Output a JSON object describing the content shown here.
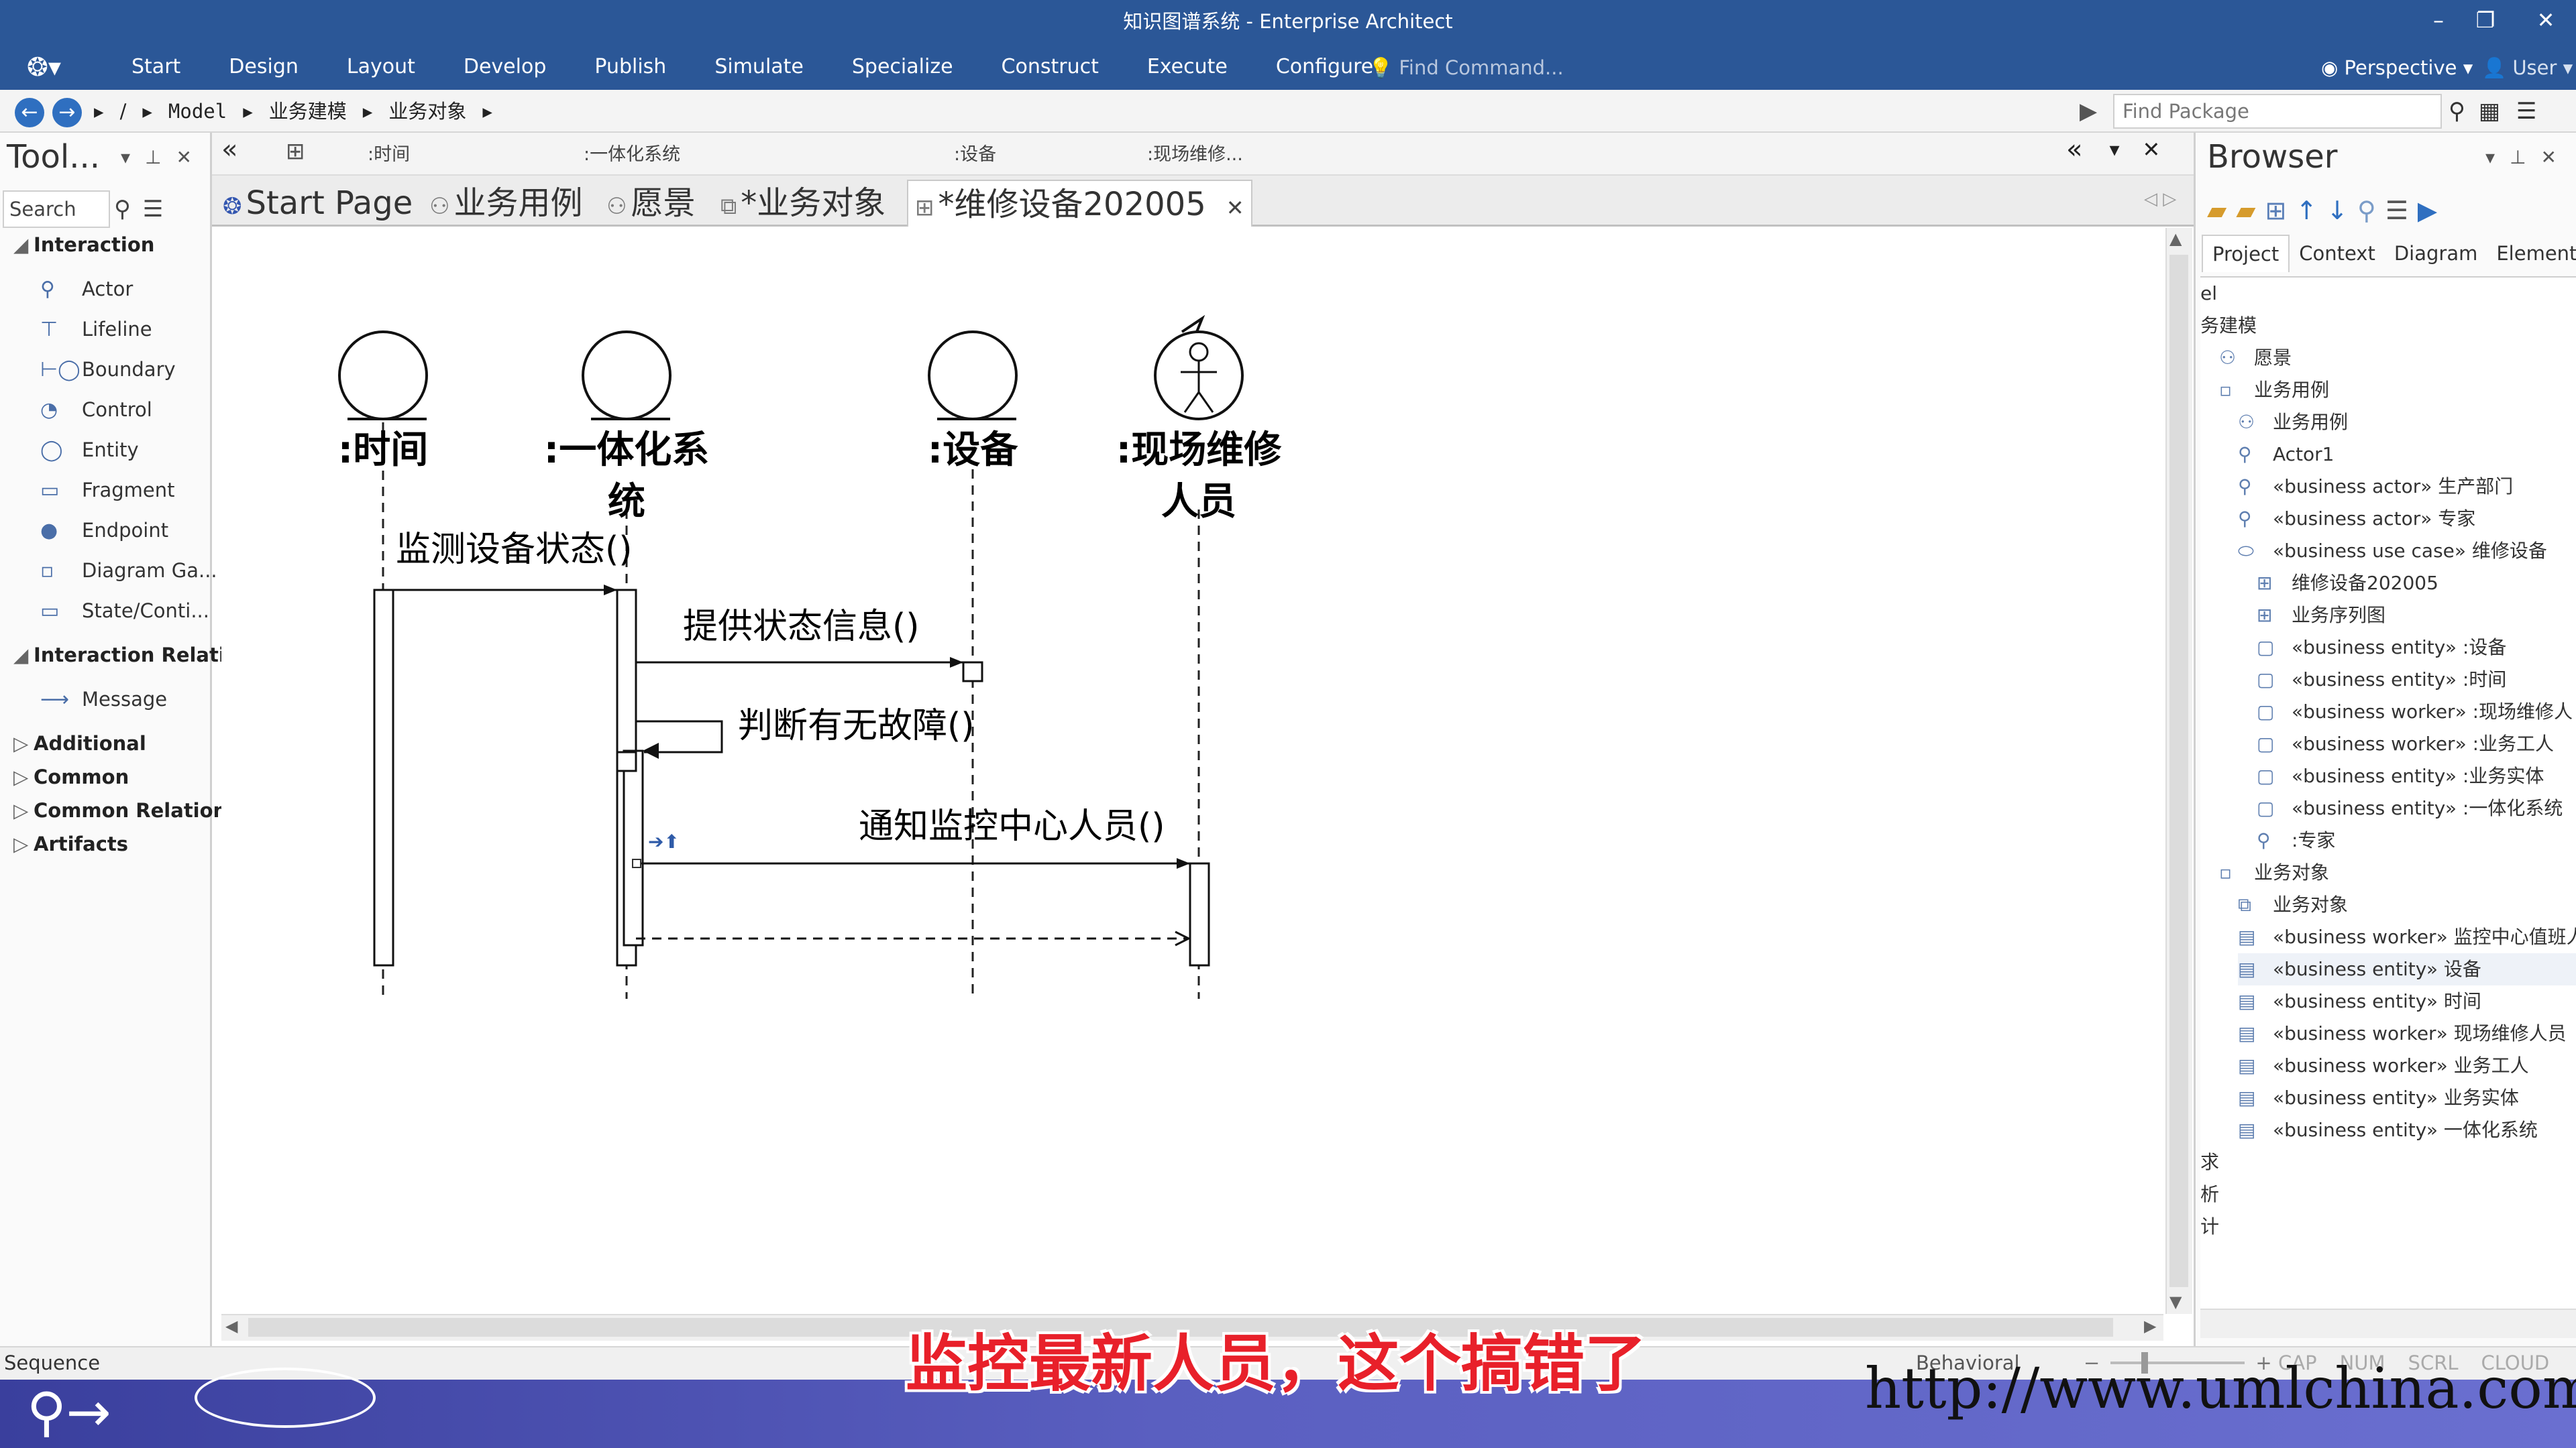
{
  "window": {
    "title": "知识图谱系统 - Enterprise Architect",
    "minimize_glyph": "–",
    "restore_glyph": "❐",
    "close_glyph": "✕"
  },
  "ribbon": {
    "logo_icon": "ea-logo-icon",
    "menu": [
      "Start",
      "Design",
      "Layout",
      "Develop",
      "Publish",
      "Simulate",
      "Specialize",
      "Construct",
      "Execute",
      "Configure"
    ],
    "find_command_placeholder": "Find Command...",
    "perspective_label": "Perspective",
    "user_label": "User"
  },
  "navbar": {
    "breadcrumbs": [
      "/",
      "Model",
      "业务建模",
      "业务对象"
    ],
    "find_package_placeholder": "Find Package"
  },
  "toolbox": {
    "title": "Tool...",
    "search_placeholder": "Search",
    "groups": [
      {
        "label": "Interaction",
        "expanded": true,
        "items": [
          {
            "label": "Actor",
            "icon": "actor-icon"
          },
          {
            "label": "Lifeline",
            "icon": "lifeline-icon"
          },
          {
            "label": "Boundary",
            "icon": "boundary-icon"
          },
          {
            "label": "Control",
            "icon": "control-icon"
          },
          {
            "label": "Entity",
            "icon": "entity-icon"
          },
          {
            "label": "Fragment",
            "icon": "fragment-icon"
          },
          {
            "label": "Endpoint",
            "icon": "endpoint-icon"
          },
          {
            "label": "Diagram Ga...",
            "icon": "diagram-gate-icon"
          },
          {
            "label": "State/Conti...",
            "icon": "state-continuation-icon"
          }
        ]
      },
      {
        "label": "Interaction Relatio",
        "expanded": true,
        "items": [
          {
            "label": "Message",
            "icon": "message-arrow-icon"
          }
        ]
      },
      {
        "label": "Additional",
        "expanded": false,
        "items": []
      },
      {
        "label": "Common",
        "expanded": false,
        "items": []
      },
      {
        "label": "Common Relations",
        "expanded": false,
        "items": []
      },
      {
        "label": "Artifacts",
        "expanded": false,
        "items": []
      }
    ]
  },
  "diagram_header": {
    "labels": [
      ":时间",
      ":一体化系统",
      ":设备",
      ":现场维修..."
    ]
  },
  "tabs": [
    {
      "label": "Start Page",
      "icon": "start-page-icon",
      "active": false
    },
    {
      "label": "业务用例",
      "icon": "use-case-diagram-icon",
      "active": false
    },
    {
      "label": "愿景",
      "icon": "use-case-diagram-icon",
      "active": false
    },
    {
      "label": "*业务对象",
      "icon": "class-diagram-icon",
      "active": false
    },
    {
      "label": "*维修设备202005",
      "icon": "sequence-diagram-icon",
      "active": true
    }
  ],
  "diagram": {
    "lifelines": [
      {
        "name": ":时间",
        "kind": "entity"
      },
      {
        "name": ":一体化系统",
        "line1": ":一体化系",
        "line2": "统",
        "kind": "entity"
      },
      {
        "name": ":设备",
        "kind": "entity"
      },
      {
        "name": ":现场维修人员",
        "line1": ":现场维修",
        "line2": "人员",
        "kind": "worker"
      }
    ],
    "messages": [
      {
        "label": "监测设备状态()",
        "from": ":时间",
        "to": ":一体化系统"
      },
      {
        "label": "提供状态信息()",
        "from": ":一体化系统",
        "to": ":设备"
      },
      {
        "label": "判断有无故障()",
        "from": ":一体化系统",
        "to": ":一体化系统"
      },
      {
        "label": "通知监控中心人员()",
        "from": ":一体化系统",
        "to": ":现场维修人员"
      },
      {
        "label": "",
        "from": ":现场维修人员",
        "to": ":一体化系统",
        "return": true
      }
    ]
  },
  "browser": {
    "title": "Browser",
    "tabs": [
      "Project",
      "Context",
      "Diagram",
      "Element"
    ],
    "active_tab": "Project",
    "tree": [
      {
        "label": "el",
        "indent": 0,
        "icon": ""
      },
      {
        "label": "务建模",
        "indent": 0,
        "icon": ""
      },
      {
        "label": "愿景",
        "indent": 1,
        "icon": "use-case-diagram-icon"
      },
      {
        "label": "业务用例",
        "indent": 1,
        "icon": "package-icon"
      },
      {
        "label": "业务用例",
        "indent": 2,
        "icon": "use-case-diagram-icon"
      },
      {
        "label": "Actor1",
        "indent": 2,
        "icon": "actor-icon"
      },
      {
        "label": "«business actor» 生产部门",
        "indent": 2,
        "icon": "actor-icon"
      },
      {
        "label": "«business actor» 专家",
        "indent": 2,
        "icon": "actor-icon"
      },
      {
        "label": "«business use case» 维修设备",
        "indent": 2,
        "icon": "use-case-icon"
      },
      {
        "label": "维修设备202005",
        "indent": 3,
        "icon": "sequence-diagram-icon"
      },
      {
        "label": "业务序列图",
        "indent": 3,
        "icon": "sequence-diagram-icon"
      },
      {
        "label": "«business entity» :设备",
        "indent": 3,
        "icon": "object-icon"
      },
      {
        "label": "«business entity» :时间",
        "indent": 3,
        "icon": "object-icon"
      },
      {
        "label": "«business worker» :现场维修人",
        "indent": 3,
        "icon": "object-icon"
      },
      {
        "label": "«business worker» :业务工人",
        "indent": 3,
        "icon": "object-icon"
      },
      {
        "label": "«business entity» :业务实体",
        "indent": 3,
        "icon": "object-icon"
      },
      {
        "label": "«business entity» :一体化系统",
        "indent": 3,
        "icon": "object-icon"
      },
      {
        "label": ":专家",
        "indent": 3,
        "icon": "actor-icon"
      },
      {
        "label": "业务对象",
        "indent": 1,
        "icon": "package-icon"
      },
      {
        "label": "业务对象",
        "indent": 2,
        "icon": "class-diagram-icon"
      },
      {
        "label": "«business worker» 监控中心值班人",
        "indent": 2,
        "icon": "class-icon"
      },
      {
        "label": "«business entity» 设备",
        "indent": 2,
        "icon": "class-icon",
        "selected": true
      },
      {
        "label": "«business entity» 时间",
        "indent": 2,
        "icon": "class-icon"
      },
      {
        "label": "«business worker» 现场维修人员",
        "indent": 2,
        "icon": "class-icon"
      },
      {
        "label": "«business worker» 业务工人",
        "indent": 2,
        "icon": "class-icon"
      },
      {
        "label": "«business entity» 业务实体",
        "indent": 2,
        "icon": "class-icon"
      },
      {
        "label": "«business entity» 一体化系统",
        "indent": 2,
        "icon": "class-icon"
      },
      {
        "label": "求",
        "indent": 0,
        "icon": ""
      },
      {
        "label": "析",
        "indent": 0,
        "icon": ""
      },
      {
        "label": "计",
        "indent": 0,
        "icon": ""
      }
    ]
  },
  "statusbar": {
    "left": "Sequence",
    "diagram_type": "Behavioral",
    "zoom_minus": "−",
    "zoom_plus": "+",
    "indicators": [
      "CAP",
      "NUM",
      "SCRL",
      "CLOUD"
    ]
  },
  "overlay": {
    "subtitle": "监控最新人员，这个搞错了",
    "watermark": "http://www.umlchina.com"
  },
  "colors": {
    "title_bar": "#2b5797",
    "accent": "#2f6fc0",
    "subtitle_red": "#e8202a"
  }
}
